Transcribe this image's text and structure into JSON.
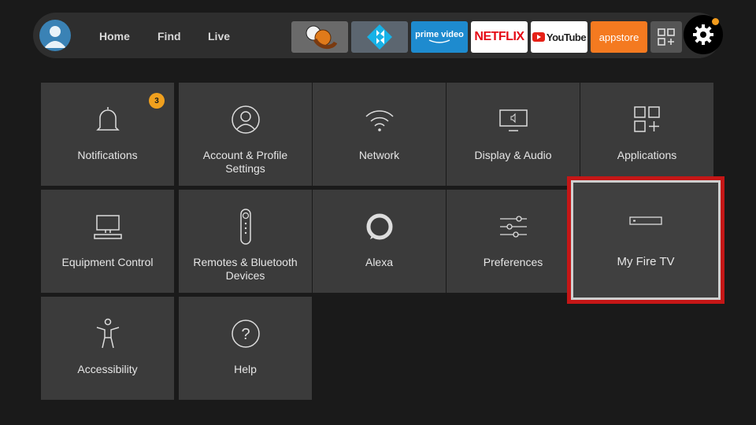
{
  "nav": {
    "links": [
      "Home",
      "Find",
      "Live"
    ]
  },
  "apps": {
    "prime_video": "prime video",
    "netflix": "NETFLIX",
    "youtube": "YouTube",
    "appstore": "appstore"
  },
  "settings": {
    "tiles": [
      {
        "label": "Notifications",
        "badge": "3",
        "icon": "bell-icon"
      },
      {
        "label": "Account & Profile Settings",
        "icon": "person-icon"
      },
      {
        "label": "Network",
        "icon": "wifi-icon"
      },
      {
        "label": "Display & Audio",
        "icon": "monitor-icon"
      },
      {
        "label": "Applications",
        "icon": "apps-grid-icon"
      },
      {
        "label": "Equipment Control",
        "icon": "tv-equipment-icon"
      },
      {
        "label": "Remotes & Bluetooth Devices",
        "icon": "remote-icon"
      },
      {
        "label": "Alexa",
        "icon": "alexa-ring-icon"
      },
      {
        "label": "Preferences",
        "icon": "sliders-icon"
      },
      {
        "label": "My Fire TV",
        "icon": "fire-tv-device-icon",
        "focused": true
      },
      {
        "label": "Accessibility",
        "icon": "accessibility-icon"
      },
      {
        "label": "Help",
        "icon": "help-icon"
      }
    ]
  },
  "colors": {
    "focus_border": "#c51616",
    "badge": "#f0a01e",
    "netflix": "#e50914",
    "appstore": "#f47a20",
    "prime_video": "#1e8bcf"
  }
}
